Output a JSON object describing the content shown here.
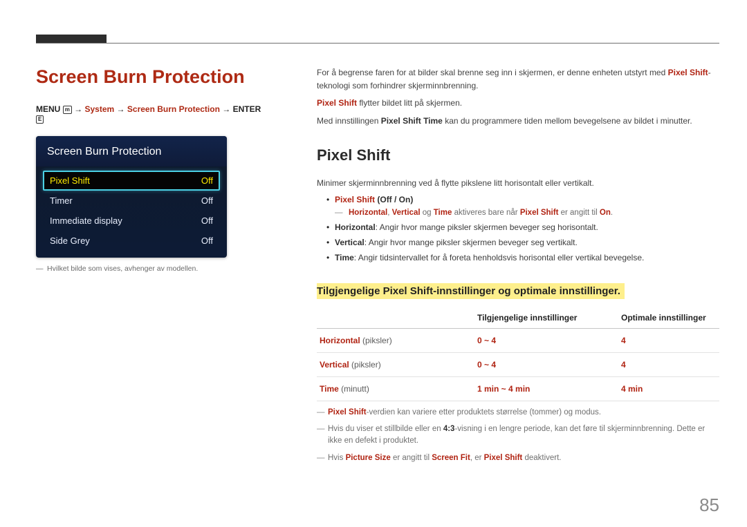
{
  "page_number": "85",
  "heading": "Screen Burn Protection",
  "breadcrumb": {
    "prefix": "MENU",
    "system": "System",
    "item": "Screen Burn Protection",
    "enter": "ENTER"
  },
  "panel": {
    "title": "Screen Burn Protection",
    "rows": [
      {
        "label": "Pixel Shift",
        "value": "Off",
        "selected": true
      },
      {
        "label": "Timer",
        "value": "Off",
        "selected": false
      },
      {
        "label": "Immediate display",
        "value": "Off",
        "selected": false
      },
      {
        "label": "Side Grey",
        "value": "Off",
        "selected": false
      }
    ]
  },
  "left_footnote": "Hvilket bilde som vises, avhenger av modellen.",
  "intro": {
    "p1a": "For å begrense faren for at bilder skal brenne seg inn i skjermen, er denne enheten utstyrt med ",
    "p1b": "Pixel Shift",
    "p1c": "-teknologi som forhindrer skjerminnbrenning.",
    "p2a": "Pixel Shift",
    "p2b": " flytter bildet litt på skjermen.",
    "p3a": "Med innstillingen ",
    "p3b": "Pixel Shift Time",
    "p3c": " kan du programmere tiden mellom bevegelsene av bildet i minutter."
  },
  "pixel_shift": {
    "h2": "Pixel Shift",
    "lead": "Minimer skjerminnbrenning ved å flytte pikslene litt horisontalt eller vertikalt.",
    "bullet1": {
      "label": "Pixel Shift",
      "values": "(Off / On)",
      "sub_prefix": "Horizontal",
      "sub_mid1": ", ",
      "sub_mid_v": "Vertical",
      "sub_mid2": " og ",
      "sub_time": "Time",
      "sub_rest": " aktiveres bare når ",
      "sub_ps": "Pixel Shift",
      "sub_tail": " er angitt til ",
      "sub_on": "On",
      "period": "."
    },
    "bullet2": {
      "label": "Horizontal",
      "text": ": Angir hvor mange piksler skjermen beveger seg horisontalt."
    },
    "bullet3": {
      "label": "Vertical",
      "text": ": Angir hvor mange piksler skjermen beveger seg vertikalt."
    },
    "bullet4": {
      "label": "Time",
      "text": ": Angir tidsintervallet for å foreta henholdsvis horisontal eller vertikal bevegelse."
    }
  },
  "table_section_title": "Tilgjengelige Pixel Shift-innstillinger og optimale innstillinger.",
  "table": {
    "col2": "Tilgjengelige innstillinger",
    "col3": "Optimale innstillinger",
    "rows": [
      {
        "param": "Horizontal",
        "unit": "(piksler)",
        "range": "0 ~ 4",
        "optimal": "4"
      },
      {
        "param": "Vertical",
        "unit": "(piksler)",
        "range": "0 ~ 4",
        "optimal": "4"
      },
      {
        "param": "Time",
        "unit": "(minutt)",
        "range": "1 min ~ 4 min",
        "optimal": "4 min"
      }
    ]
  },
  "notes": {
    "n1a": "Pixel Shift",
    "n1b": "-verdien kan variere etter produktets størrelse (tommer) og modus.",
    "n2a": "Hvis du viser et stillbilde eller en ",
    "n2b": "4:3",
    "n2c": "-visning i en lengre periode, kan det føre til skjerminnbrenning. Dette er ikke en defekt i produktet.",
    "n3a": "Hvis ",
    "n3b": "Picture Size",
    "n3c": " er angitt til ",
    "n3d": "Screen Fit",
    "n3e": ", er ",
    "n3f": "Pixel Shift",
    "n3g": " deaktivert."
  }
}
